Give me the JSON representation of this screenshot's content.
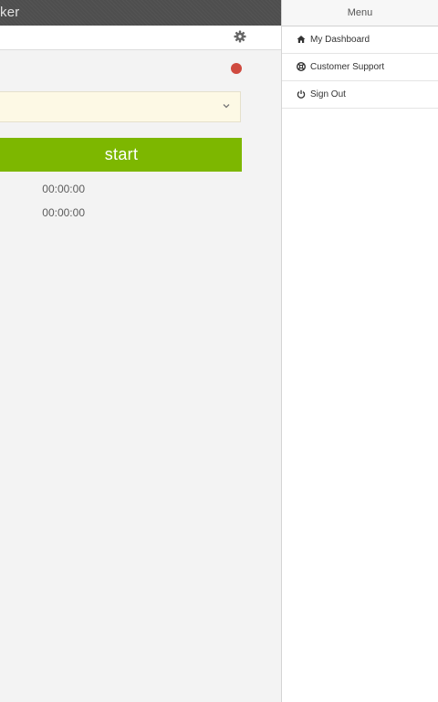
{
  "app": {
    "title": "ker"
  },
  "main": {
    "start_label": "start",
    "times": [
      "00:00:00",
      "00:00:00"
    ],
    "status_color": "#cf4a3f",
    "accent_color": "#7db700"
  },
  "icons": {
    "settings": "gear-icon",
    "select": "chevron-down-icon",
    "dashboard": "home-icon",
    "support": "lifebuoy-icon",
    "signout": "power-icon"
  },
  "menu": {
    "title": "Menu",
    "items": [
      {
        "label": "My Dashboard",
        "icon": "home-icon"
      },
      {
        "label": "Customer Support",
        "icon": "lifebuoy-icon"
      },
      {
        "label": "Sign Out",
        "icon": "power-icon"
      }
    ]
  }
}
